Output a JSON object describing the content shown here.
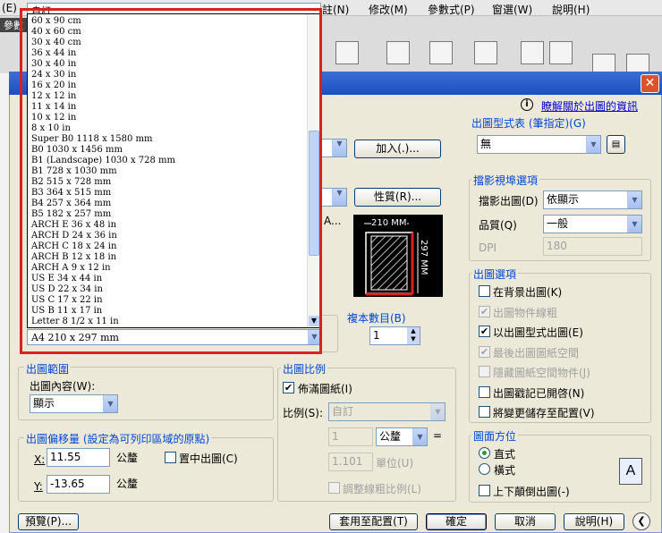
{
  "menubar": {
    "items": [
      "(E)",
      "註(N)",
      "修改(M)",
      "參數式(P)",
      "窗選(W)",
      "說明(H)"
    ],
    "partial": "自訂"
  },
  "cad_tab": "參數",
  "dialog": {
    "info_link": "瞭解關於出圖的資訊",
    "add_button": "加入(.)...",
    "properties_button": "性質(R)...",
    "paper_list": [
      "60 x 90 cm",
      "40 x 60 cm",
      "30 x 40 cm",
      "36 x 44 in",
      "30 x 40 in",
      "24 x 30 in",
      "16 x 20 in",
      "12 x 12 in",
      "11 x 14 in",
      "10 x 12 in",
      "8 x 10 in",
      "Super B0 1118 x 1580 mm",
      "B0 1030 x 1456 mm",
      "B1 (Landscape) 1030 x 728 mm",
      "B1 728 x 1030 mm",
      "B2 515 x 728 mm",
      "B3 364 x 515 mm",
      "B4 257 x 364 mm",
      "B5 182 x 257 mm",
      "ARCH E 36 x 48 in",
      "ARCH D 24 x 36 in",
      "ARCH C 18 x 24 in",
      "ARCH B 12 x 18 in",
      "ARCH A 9 x 12 in",
      "US E 34 x 44 in",
      "US D 22 x 34 in",
      "US C 17 x 22 in",
      "US B 11 x 17 in",
      "Letter 8 1/2 x 11 in"
    ],
    "paper_selected": "A4 210 x 297 mm",
    "preview": {
      "width_label": "210 MM",
      "height_label": "297 MM"
    },
    "copies": {
      "label": "複本數目(B)",
      "value": "1"
    },
    "plot_style_table": {
      "title": "出圖型式表 (筆指定)(G)",
      "value": "無"
    },
    "shaded": {
      "title": "擋影視埠選項",
      "shade_label": "擋影出圖(D)",
      "shade_value": "依顯示",
      "quality_label": "品質(Q)",
      "quality_value": "一般",
      "dpi_label": "DPI",
      "dpi_value": "180"
    },
    "plot_options": {
      "title": "出圖選項",
      "items": [
        {
          "label": "在背景出圖(K)",
          "checked": false,
          "disabled": false
        },
        {
          "label": "出圖物件線粗",
          "checked": true,
          "disabled": true
        },
        {
          "label": "以出圖型式出圖(E)",
          "checked": true,
          "disabled": false
        },
        {
          "label": "最後出圖圖紙空間",
          "checked": true,
          "disabled": true
        },
        {
          "label": "隱藏圖紙空間物件(J)",
          "checked": false,
          "disabled": true
        },
        {
          "label": "出圖戳記已開啓(N)",
          "checked": false,
          "disabled": false
        },
        {
          "label": "將變更儲存至配置(V)",
          "checked": false,
          "disabled": false
        }
      ]
    },
    "plot_area": {
      "title": "出圖範圍",
      "what_label": "出圖內容(W):",
      "what_value": "顯示"
    },
    "plot_offset": {
      "title": "出圖偏移量 (設定為可列印區域的原點)",
      "x_label": "X:",
      "x_value": "11.55",
      "y_label": "Y:",
      "y_value": "-13.65",
      "unit": "公釐",
      "center_label": "置中出圖(C)"
    },
    "plot_scale": {
      "title": "出圖比例",
      "fit_label": "佈滿圖紙(I)",
      "scale_label": "比例(S):",
      "scale_value": "自訂",
      "num_value": "1",
      "num_unit": "公釐",
      "equals": "=",
      "den_value": "1.101",
      "den_unit": "單位(U)",
      "lineweight_label": "調整線粗比例(L)"
    },
    "orientation": {
      "title": "圖面方位",
      "portrait": "直式",
      "landscape": "橫式",
      "upside_down": "上下顛倒出圖(-)",
      "icon_letter": "A"
    },
    "buttons": {
      "preview": "預覽(P)...",
      "apply": "套用至配置(T)",
      "ok": "確定",
      "cancel": "取消",
      "help": "說明(H)"
    }
  },
  "colors": {
    "accent": "#0046d5",
    "highlight_frame": "#d9221d",
    "titlebar": "#2a5fcf"
  }
}
